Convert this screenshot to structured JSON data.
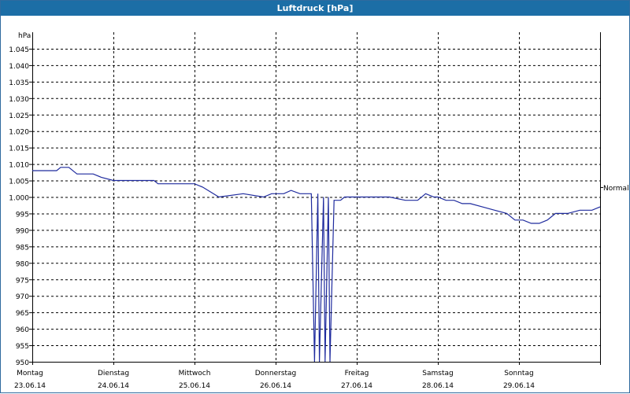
{
  "window": {
    "title": "Luftdruck [hPa]"
  },
  "colors": {
    "title_bar": "#1c6ea6",
    "series_line": "#1f2b9e",
    "grid": "#000000"
  },
  "chart_data": {
    "type": "line",
    "title": "Luftdruck [hPa]",
    "ylabel": "hPa",
    "ylim": [
      950,
      1050
    ],
    "y_ticks": [
      "1.045",
      "1.040",
      "1.035",
      "1.030",
      "1.025",
      "1.020",
      "1.015",
      "1.010",
      "1.005",
      "1.000",
      "995",
      "990",
      "985",
      "980",
      "975",
      "970",
      "965",
      "960",
      "955",
      "950"
    ],
    "y_tick_values": [
      1045,
      1040,
      1035,
      1030,
      1025,
      1020,
      1015,
      1010,
      1005,
      1000,
      995,
      990,
      985,
      980,
      975,
      970,
      965,
      960,
      955,
      950
    ],
    "x_days": [
      {
        "day": "Montag",
        "date": "23.06.14"
      },
      {
        "day": "Dienstag",
        "date": "24.06.14"
      },
      {
        "day": "Mittwoch",
        "date": "25.06.14"
      },
      {
        "day": "Donnerstag",
        "date": "26.06.14"
      },
      {
        "day": "Freitag",
        "date": "27.06.14"
      },
      {
        "day": "Samstag",
        "date": "28.06.14"
      },
      {
        "day": "Sonntag",
        "date": "29.06.14"
      }
    ],
    "xlim": [
      0,
      7
    ],
    "grid": true,
    "reference_line": {
      "label": "Normal",
      "value": 1003
    },
    "series": [
      {
        "x": [
          0.0,
          0.3,
          0.35,
          0.45,
          0.55,
          0.75,
          0.85,
          1.0,
          1.1,
          1.2,
          1.5,
          1.55,
          2.0,
          2.1,
          2.3,
          2.6,
          2.85,
          2.95,
          3.0,
          3.1,
          3.19,
          3.3,
          3.39,
          3.44,
          3.48,
          3.52,
          3.54,
          3.59,
          3.61,
          3.65,
          3.67,
          3.72,
          3.8,
          3.85,
          3.9,
          4.0,
          4.4,
          4.6,
          4.75,
          4.85,
          4.95,
          5.0,
          5.1,
          5.2,
          5.3,
          5.4,
          5.55,
          5.7,
          5.85,
          5.95,
          6.05,
          6.15,
          6.25,
          6.35,
          6.45,
          6.6,
          6.75,
          6.9,
          7.0
        ],
        "y": [
          1008,
          1008,
          1009,
          1009,
          1007,
          1007,
          1006,
          1005,
          1005,
          1005,
          1005,
          1004,
          1004,
          1003,
          1000,
          1001,
          1000,
          1001,
          1001,
          1001,
          1002,
          1001,
          1001,
          1001,
          950,
          1001,
          950,
          1000,
          950,
          1000,
          950,
          999,
          999,
          1000,
          1000,
          1000,
          1000,
          999,
          999,
          1001,
          1000,
          1000,
          999,
          999,
          998,
          998,
          997,
          996,
          995,
          993,
          993,
          992,
          992,
          993,
          995,
          995,
          996,
          996,
          997
        ]
      }
    ]
  }
}
